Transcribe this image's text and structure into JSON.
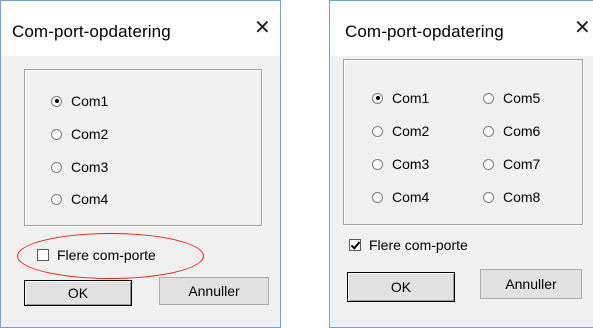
{
  "dialog_left": {
    "title": "Com-port-opdatering",
    "close_glyph": "✕",
    "ports": [
      "Com1",
      "Com2",
      "Com3",
      "Com4"
    ],
    "selected_port": "Com1",
    "multi_ports_label": "Flere com-porte",
    "multi_ports_checked": false,
    "ok_label": "OK",
    "cancel_label": "Annuller",
    "annotation_color": "#e0201b"
  },
  "dialog_right": {
    "title": "Com-port-opdatering",
    "close_glyph": "✕",
    "ports_col1": [
      "Com1",
      "Com2",
      "Com3",
      "Com4"
    ],
    "ports_col2": [
      "Com5",
      "Com6",
      "Com7",
      "Com8"
    ],
    "selected_port": "Com1",
    "multi_ports_label": "Flere com-porte",
    "multi_ports_checked": true,
    "ok_label": "OK",
    "cancel_label": "Annuller"
  }
}
